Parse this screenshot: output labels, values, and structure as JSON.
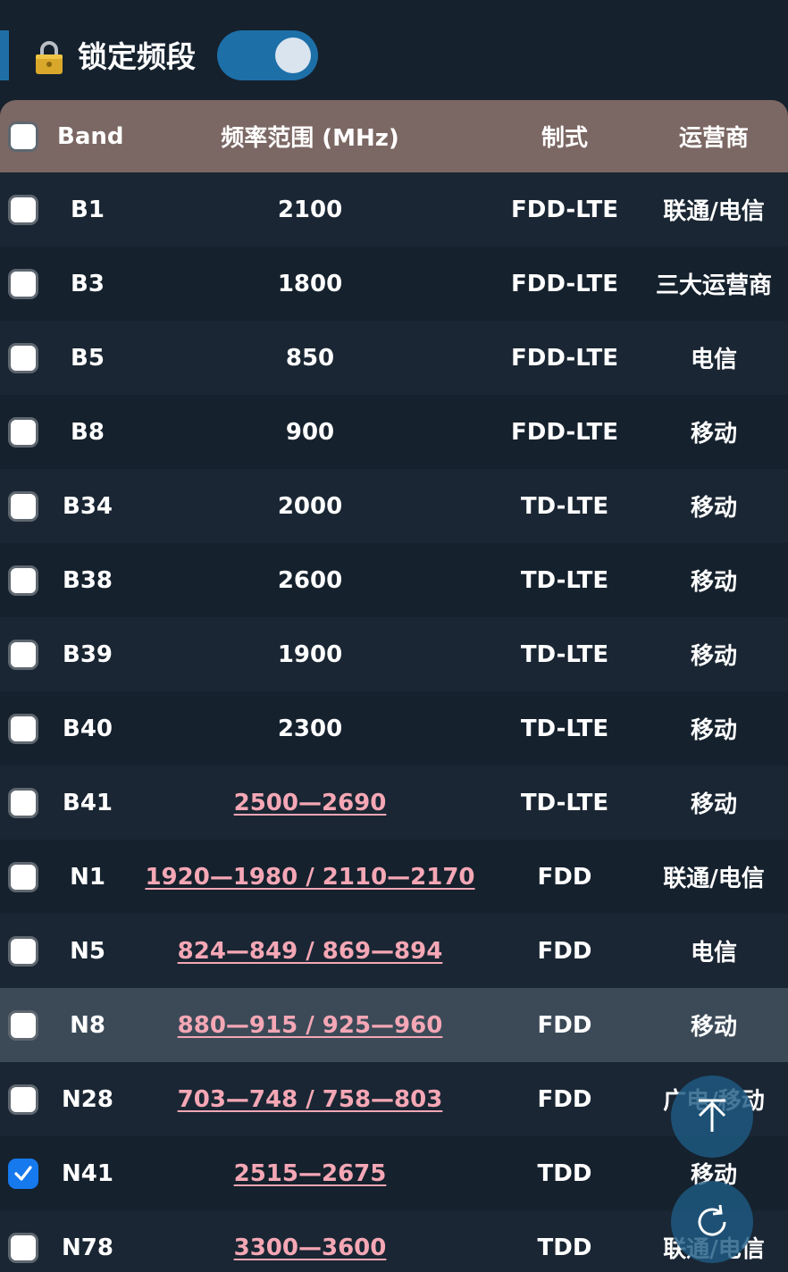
{
  "header": {
    "title": "锁定频段",
    "lock_icon": "lock-icon",
    "toggle_on": true
  },
  "table": {
    "columns": {
      "band": "Band",
      "freq": "频率范围 (MHz)",
      "mode": "制式",
      "operator": "运营商"
    },
    "rows": [
      {
        "band": "B1",
        "freq": "2100",
        "mode": "FDD-LTE",
        "operator": "联通/电信",
        "checked": false,
        "freq_link": false
      },
      {
        "band": "B3",
        "freq": "1800",
        "mode": "FDD-LTE",
        "operator": "三大运营商",
        "checked": false,
        "freq_link": false
      },
      {
        "band": "B5",
        "freq": "850",
        "mode": "FDD-LTE",
        "operator": "电信",
        "checked": false,
        "freq_link": false
      },
      {
        "band": "B8",
        "freq": "900",
        "mode": "FDD-LTE",
        "operator": "移动",
        "checked": false,
        "freq_link": false
      },
      {
        "band": "B34",
        "freq": "2000",
        "mode": "TD-LTE",
        "operator": "移动",
        "checked": false,
        "freq_link": false
      },
      {
        "band": "B38",
        "freq": "2600",
        "mode": "TD-LTE",
        "operator": "移动",
        "checked": false,
        "freq_link": false
      },
      {
        "band": "B39",
        "freq": "1900",
        "mode": "TD-LTE",
        "operator": "移动",
        "checked": false,
        "freq_link": false
      },
      {
        "band": "B40",
        "freq": "2300",
        "mode": "TD-LTE",
        "operator": "移动",
        "checked": false,
        "freq_link": false
      },
      {
        "band": "B41",
        "freq": "2500—2690",
        "mode": "TD-LTE",
        "operator": "移动",
        "checked": false,
        "freq_link": true
      },
      {
        "band": "N1",
        "freq": "1920—1980 / 2110—2170",
        "mode": "FDD",
        "operator": "联通/电信",
        "checked": false,
        "freq_link": true
      },
      {
        "band": "N5",
        "freq": "824—849 / 869—894",
        "mode": "FDD",
        "operator": "电信",
        "checked": false,
        "freq_link": true
      },
      {
        "band": "N8",
        "freq": "880—915 / 925—960",
        "mode": "FDD",
        "operator": "移动",
        "checked": false,
        "freq_link": true,
        "highlighted": true
      },
      {
        "band": "N28",
        "freq": "703—748 / 758—803",
        "mode": "FDD",
        "operator": "广电/移动",
        "checked": false,
        "freq_link": true
      },
      {
        "band": "N41",
        "freq": "2515—2675",
        "mode": "TDD",
        "operator": "移动",
        "checked": true,
        "freq_link": true
      },
      {
        "band": "N78",
        "freq": "3300—3600",
        "mode": "TDD",
        "operator": "联通/电信",
        "checked": false,
        "freq_link": true
      }
    ]
  },
  "floating": {
    "scroll_top_icon": "arrow-up-icon",
    "refresh_icon": "refresh-icon"
  },
  "colors": {
    "background": "#15212d",
    "header_row": "#7b6763",
    "toggle": "#1d6fa8",
    "link": "#f5a7b5",
    "checked": "#1679ee"
  }
}
